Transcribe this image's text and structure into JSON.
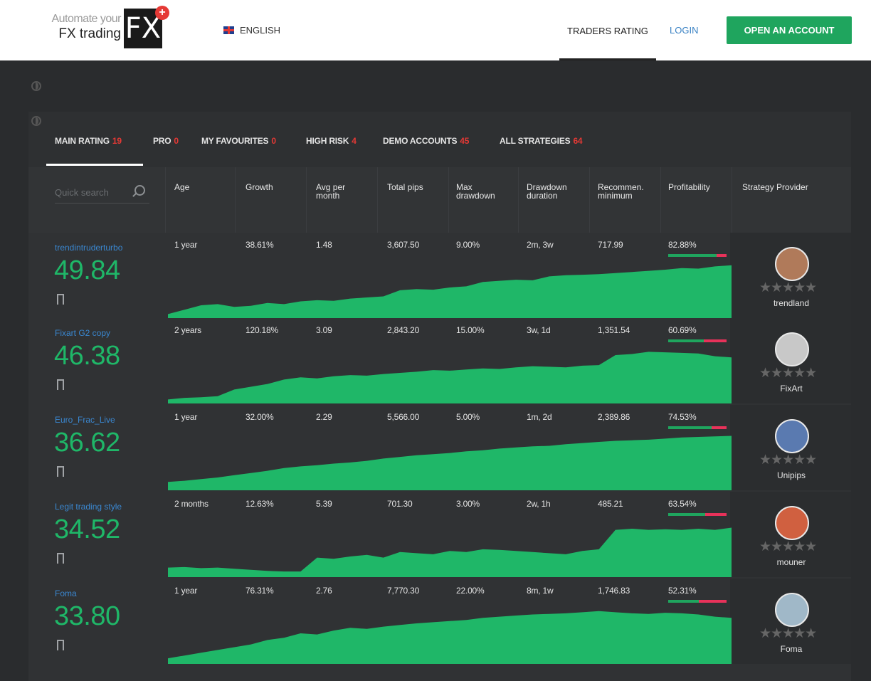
{
  "header": {
    "logo_line1": "Automate your",
    "logo_line2": "FX trading",
    "logo_mark": "FX",
    "logo_plus": "+",
    "language": "ENGLISH",
    "nav_rating": "TRADERS RATING",
    "nav_login": "LOGIN",
    "open_account": "OPEN AN ACCOUNT"
  },
  "tabs": [
    {
      "label": "MAIN RATING",
      "count": "19"
    },
    {
      "label": "PRO",
      "count": "0"
    },
    {
      "label": "MY FAVOURITES",
      "count": "0"
    },
    {
      "label": "HIGH RISK",
      "count": "4"
    },
    {
      "label": "DEMO ACCOUNTS",
      "count": "45"
    },
    {
      "label": "ALL STRATEGIES",
      "count": "64"
    }
  ],
  "search": {
    "placeholder": "Quick search"
  },
  "columns": {
    "age": "Age",
    "growth": "Growth",
    "avg1": "Avg per",
    "avg2": "month",
    "pips": "Total pips",
    "maxdd1": "Max",
    "maxdd2": "drawdown",
    "ddd1": "Drawdown",
    "ddd2": "duration",
    "rec1": "Recommen.",
    "rec2": "minimum",
    "profit": "Profitability",
    "provider": "Strategy Provider"
  },
  "rows": [
    {
      "name": "trendintruderturbo",
      "score": "49.84",
      "age": "1 year",
      "growth": "38.61%",
      "avg": "1.48",
      "pips": "3,607.50",
      "maxdd": "9.00%",
      "ddd": "2m, 3w",
      "rec": "717.99",
      "profit": "82.88%",
      "profit_value": 0.8288,
      "provider": "trendland",
      "stars": "★★★★★"
    },
    {
      "name": "Fixart G2 copy",
      "score": "46.38",
      "age": "2 years",
      "growth": "120.18%",
      "avg": "3.09",
      "pips": "2,843.20",
      "maxdd": "15.00%",
      "ddd": "3w, 1d",
      "rec": "1,351.54",
      "profit": "60.69%",
      "profit_value": 0.6069,
      "provider": "FixArt",
      "stars": "★★★★★"
    },
    {
      "name": "Euro_Frac_Live",
      "score": "36.62",
      "age": "1 year",
      "growth": "32.00%",
      "avg": "2.29",
      "pips": "5,566.00",
      "maxdd": "5.00%",
      "ddd": "1m, 2d",
      "rec": "2,389.86",
      "profit": "74.53%",
      "profit_value": 0.7453,
      "provider": "Unipips",
      "stars": "★★★★★"
    },
    {
      "name": "Legit trading style",
      "score": "34.52",
      "age": "2 months",
      "growth": "12.63%",
      "avg": "5.39",
      "pips": "701.30",
      "maxdd": "3.00%",
      "ddd": "2w, 1h",
      "rec": "485.21",
      "profit": "63.54%",
      "profit_value": 0.6354,
      "provider": "mouner",
      "stars": "★★★★★"
    },
    {
      "name": "Foma",
      "score": "33.80",
      "age": "1 year",
      "growth": "76.31%",
      "avg": "2.76",
      "pips": "7,770.30",
      "maxdd": "22.00%",
      "ddd": "8m, 1w",
      "rec": "1,746.83",
      "profit": "52.31%",
      "profit_value": 0.5231,
      "provider": "Foma",
      "stars": "★★★★★"
    }
  ],
  "colors": {
    "green": "#1fb768",
    "red": "#e8325a",
    "link": "#3a87d0"
  }
}
